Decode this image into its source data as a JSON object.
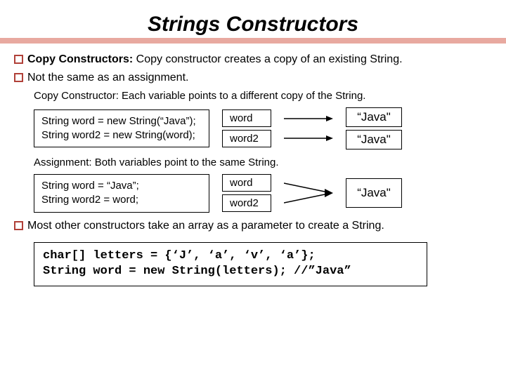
{
  "title": "Strings Constructors",
  "b1_strong": "Copy Constructors:",
  "b1_rest": " Copy constructor creates a copy of an existing String.",
  "b2": "Not the same as an assignment.",
  "sub1": "Copy Constructor: Each variable points to a different copy of the String.",
  "code1_l1": "String word = new String(“Java”);",
  "code1_l2": "String word2 = new String(word);",
  "label_word": "word",
  "label_word2": "word2",
  "val_java": "“Java\"",
  "sub2": "Assignment: Both variables point to the same String.",
  "code2_l1": "String word = “Java”;",
  "code2_l2": "String word2 = word;",
  "b3": "Most other constructors take an array as a parameter to create a String.",
  "mono_l1": "char[] letters = {‘J’, ‘a’, ‘v’, ‘a’};",
  "mono_l2": "String word = new String(letters); //”Java”"
}
